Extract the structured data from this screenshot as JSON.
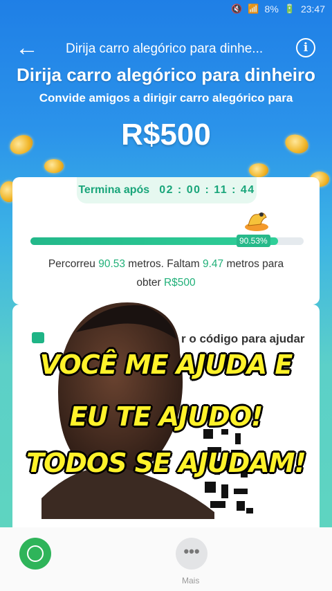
{
  "status_bar": {
    "battery": "8%",
    "time": "23:47"
  },
  "header": {
    "title": "Dirija carro alegórico para dinhe..."
  },
  "hero": {
    "headline": "Dirija carro alegórico para dinheiro",
    "subline": "Convide amigos a dirigir carro alegórico para",
    "prize": "R$500"
  },
  "progress_card": {
    "ends_label": "Termina após",
    "countdown": "02 : 00 : 11 : 44",
    "percent_label": "90.53%",
    "percent_value": 0.9053,
    "text_prefix": "Percorreu ",
    "traveled": "90.53",
    "text_middle": " metros. Faltam ",
    "remaining": "9.47",
    "text_suffix": " metros para",
    "text_line2_prefix": "obter ",
    "reward": "R$500"
  },
  "share_card": {
    "hint": "r o código para ajudar"
  },
  "caption": {
    "line1": "VOCÊ ME AJUDA E",
    "line2": "EU TE AJUDO!",
    "line3": "TODOS SE AJUDAM!"
  },
  "bottom_bar": {
    "more_label": "Mais",
    "more_icon": "•••"
  },
  "colors": {
    "accent_green": "#21b079",
    "caption_yellow": "#fff22a",
    "header_blue": "#1f7fe6"
  }
}
